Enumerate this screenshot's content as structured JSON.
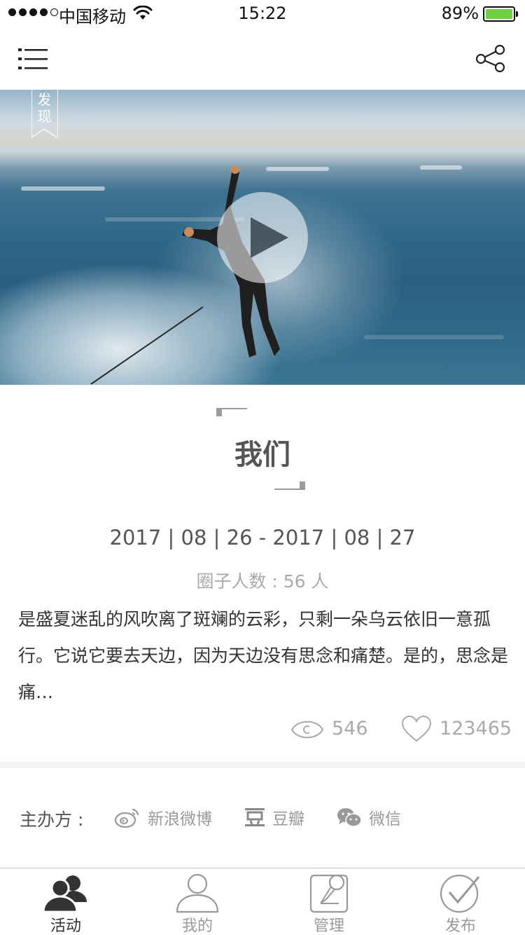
{
  "status_bar": {
    "carrier": "中国移动",
    "time": "15:22",
    "battery_percent": "89%"
  },
  "hero": {
    "tag": "发现"
  },
  "event": {
    "title": "我们",
    "date_range": "2017 | 08 | 26 - 2017 | 08 | 27",
    "member_count": "圈子人数 : 56 人",
    "description": "是盛夏迷乱的风吹离了斑斓的云彩，只剩一朵乌云依旧一意孤行。它说它要去天边，因为天边没有思念和痛楚。是的，思念是痛…",
    "views": "546",
    "likes": "123465"
  },
  "organizers": {
    "label": "主办方 :",
    "items": [
      {
        "name": "新浪微博",
        "icon": "weibo-icon"
      },
      {
        "name": "豆瓣",
        "icon": "douban-icon"
      },
      {
        "name": "微信",
        "icon": "wechat-icon"
      }
    ]
  },
  "tabs": [
    {
      "label": "活动",
      "icon": "people-icon",
      "active": true
    },
    {
      "label": "我的",
      "icon": "user-icon",
      "active": false
    },
    {
      "label": "管理",
      "icon": "manage-icon",
      "active": false
    },
    {
      "label": "发布",
      "icon": "publish-check-icon",
      "active": false
    }
  ],
  "colors": {
    "battery": "#6fd13f",
    "title": "#555555",
    "muted": "#aaaaaa",
    "active_tab": "#333333"
  }
}
